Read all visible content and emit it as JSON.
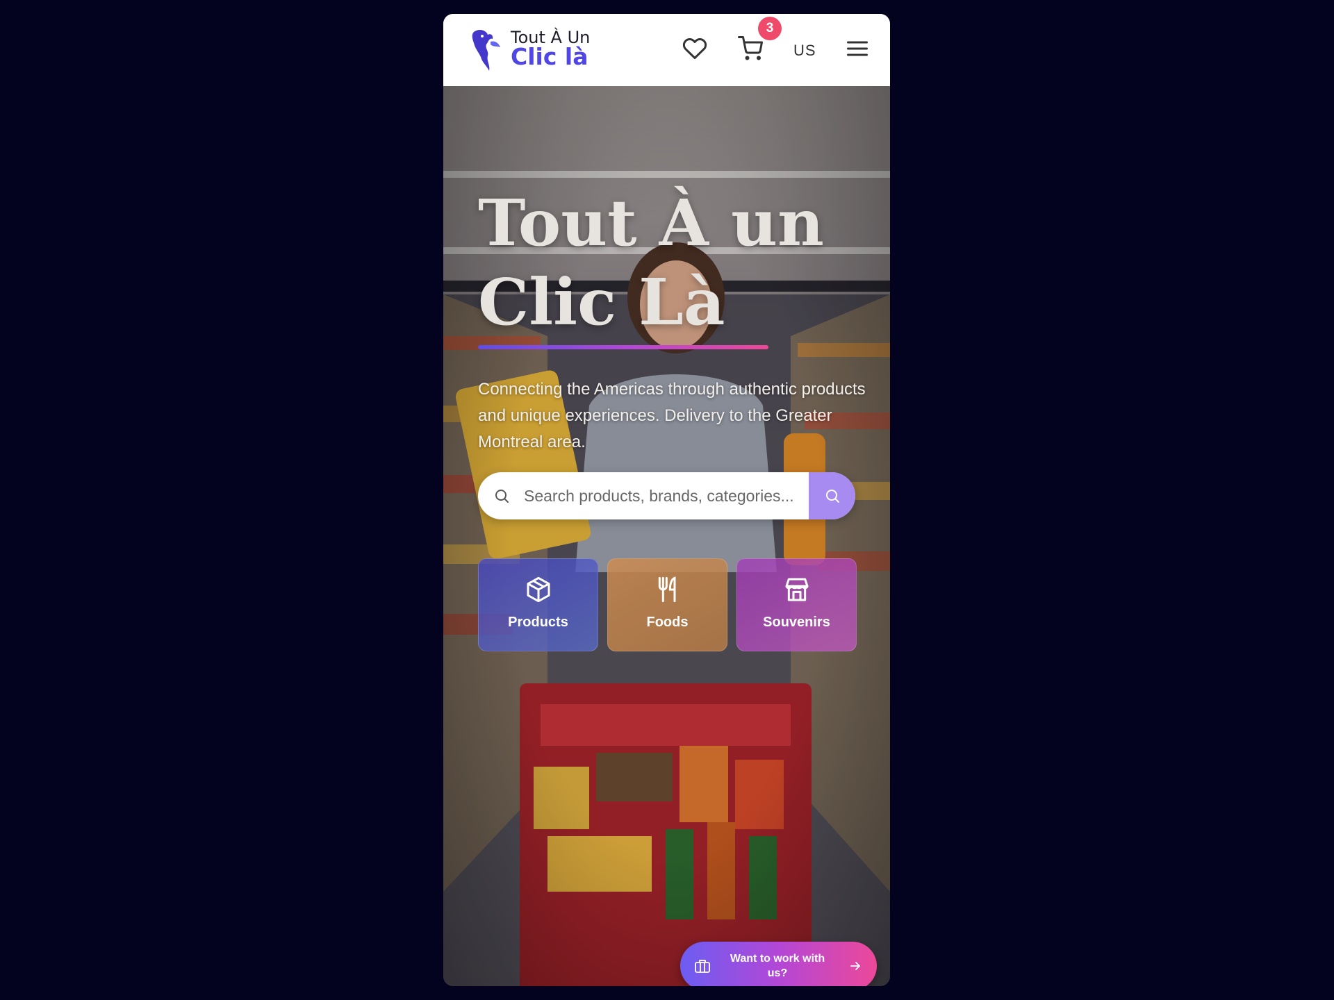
{
  "header": {
    "logo_line1": "Tout À Un",
    "logo_line2": "Clic là",
    "cart_count": "3",
    "region": "US",
    "icons": [
      "logo-americas-bird-icon",
      "heart-icon",
      "cart-icon",
      "menu-icon"
    ]
  },
  "hero": {
    "title": "Tout À un Clic Là",
    "subtitle": "Connecting the Americas through authentic products and unique experiences. Delivery to the Greater Montreal area.",
    "search_placeholder": "Search products, brands, categories...",
    "categories": [
      {
        "label": "Products",
        "icon": "box-icon"
      },
      {
        "label": "Foods",
        "icon": "utensils-icon"
      },
      {
        "label": "Souvenirs",
        "icon": "store-icon"
      }
    ],
    "cta_label": "Want to work with us?"
  },
  "colors": {
    "page_background": "#03021f",
    "brand": "#4f46e5",
    "badge": "#ef4a6a",
    "search_button": "#a78bf0",
    "cta_gradient": [
      "#6c5df2",
      "#b347d6",
      "#ec4899"
    ]
  }
}
